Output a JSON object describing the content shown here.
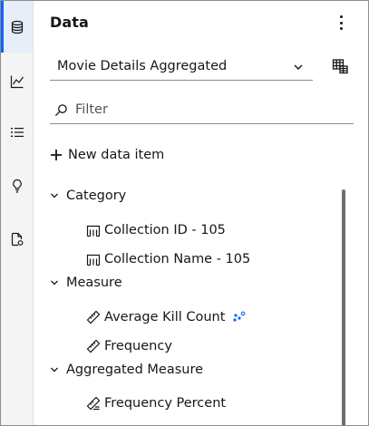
{
  "rail": {
    "items": [
      {
        "icon": "database-icon",
        "active": true
      },
      {
        "icon": "line-chart-icon",
        "active": false
      },
      {
        "icon": "list-icon",
        "active": false
      },
      {
        "icon": "lightbulb-icon",
        "active": false
      },
      {
        "icon": "report-settings-icon",
        "active": false
      }
    ]
  },
  "panel": {
    "title": "Data",
    "menu_icon": "overflow-menu-vertical-icon",
    "source_select": {
      "value": "Movie Details Aggregated"
    },
    "table_icon": "data-table-icon",
    "filter": {
      "placeholder": "Filter"
    },
    "new_item_label": "New data item",
    "groups": [
      {
        "label": "Category",
        "items": [
          {
            "label": "Collection ID - 105",
            "icon": "category-icon"
          },
          {
            "label": "Collection Name - 105",
            "icon": "category-icon"
          }
        ]
      },
      {
        "label": "Measure",
        "items": [
          {
            "label": "Average Kill Count",
            "icon": "measure-icon",
            "badge": "calculated-icon"
          },
          {
            "label": "Frequency",
            "icon": "measure-icon"
          }
        ]
      },
      {
        "label": "Aggregated Measure",
        "items": [
          {
            "label": "Frequency Percent",
            "icon": "aggregated-measure-icon"
          }
        ]
      }
    ]
  },
  "colors": {
    "accent": "#0f62fe",
    "rail_bg": "#f4f4f4",
    "active_bg": "#e5eef9",
    "text": "#161616"
  }
}
